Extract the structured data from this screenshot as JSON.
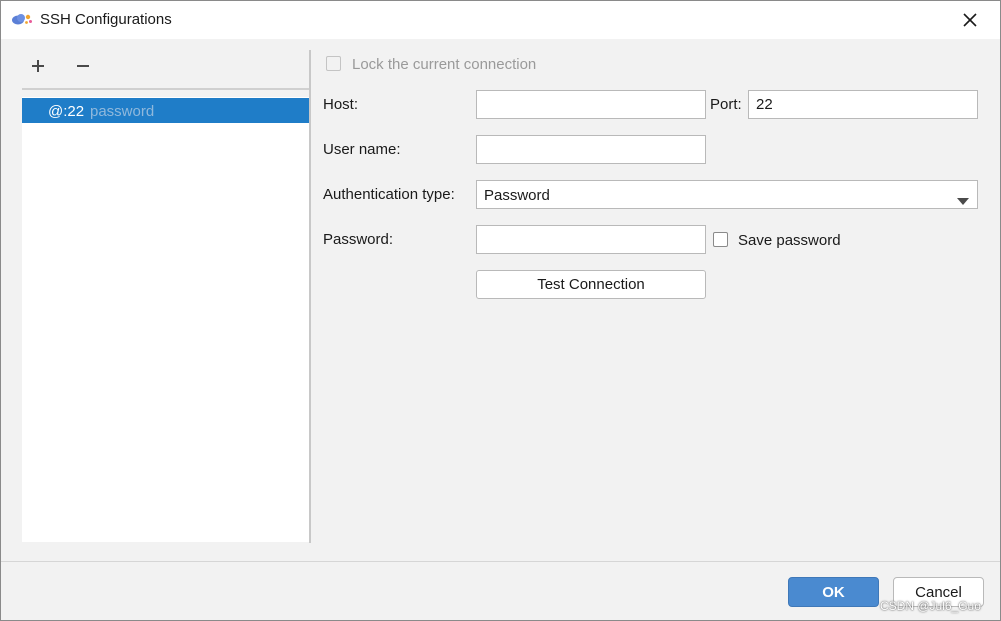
{
  "window": {
    "title": "SSH Configurations",
    "app_icon": "cloud-config-icon",
    "close_icon": "close-icon"
  },
  "left_panel": {
    "add_icon": "plus-icon",
    "remove_icon": "minus-icon",
    "connections": [
      {
        "label": "@:22",
        "auth": "password",
        "selected": true
      }
    ]
  },
  "form": {
    "lock_label": "Lock the current connection",
    "host_label": "Host:",
    "host_value": "",
    "port_label": "Port:",
    "port_value": "22",
    "user_label": "User name:",
    "user_value": "",
    "auth_label": "Authentication type:",
    "auth_value": "Password",
    "password_label": "Password:",
    "password_value": "",
    "save_password_label": "Save password",
    "test_button": "Test Connection",
    "dropdown_icon": "chevron-down-icon"
  },
  "footer": {
    "ok": "OK",
    "cancel": "Cancel"
  },
  "watermark": "CSDN @Jul6_Guo",
  "colors": {
    "selection": "#1f7dc8",
    "ok_button": "#4a8ad0",
    "background": "#f2f2f2"
  }
}
